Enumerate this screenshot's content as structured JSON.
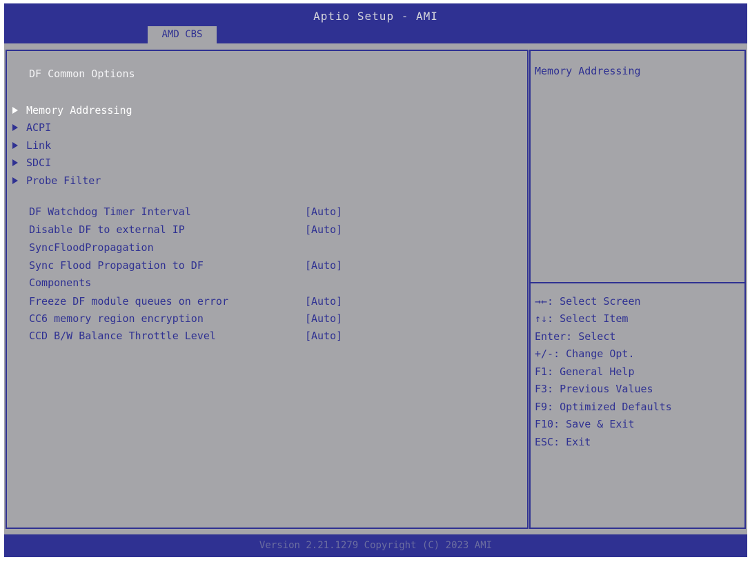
{
  "header": {
    "title": "Aptio Setup - AMI",
    "tab": "AMD CBS"
  },
  "main": {
    "section_title": "DF Common Options",
    "submenus": [
      {
        "label": "Memory Addressing",
        "selected": true
      },
      {
        "label": "ACPI"
      },
      {
        "label": "Link"
      },
      {
        "label": "SDCI"
      },
      {
        "label": "Probe Filter"
      }
    ],
    "options": [
      {
        "label": "DF Watchdog Timer Interval",
        "value": "[Auto]"
      },
      {
        "label": "Disable DF to external IP",
        "label2": "SyncFloodPropagation",
        "value": "[Auto]"
      },
      {
        "label": "Sync Flood Propagation to DF",
        "label2": "Components",
        "value": "[Auto]"
      },
      {
        "label": "Freeze DF module queues on error",
        "value": "[Auto]"
      },
      {
        "label": "CC6 memory region encryption",
        "value": "[Auto]"
      },
      {
        "label": "CCD B/W Balance Throttle Level",
        "value": "[Auto]"
      }
    ]
  },
  "help": {
    "description": "Memory Addressing",
    "keys": [
      "→←: Select Screen",
      "↑↓: Select Item",
      "Enter: Select",
      "+/-: Change Opt.",
      "F1: General Help",
      "F3: Previous Values",
      "F9: Optimized Defaults",
      "F10: Save & Exit",
      "ESC: Exit"
    ]
  },
  "footer": {
    "text": "Version 2.21.1279 Copyright (C) 2023 AMI"
  },
  "colors": {
    "bar": "#2f3192",
    "background": "#a5a5a9",
    "selected_text": "#ffffff"
  }
}
